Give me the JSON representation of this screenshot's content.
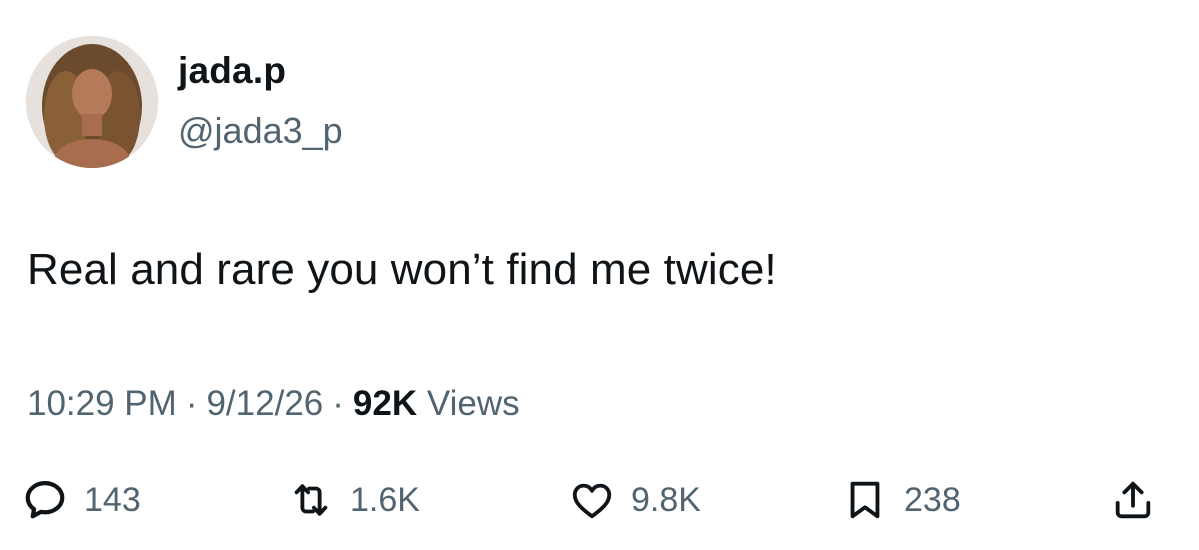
{
  "user": {
    "display_name": "jada.p",
    "handle": "@jada3_p"
  },
  "tweet": {
    "text": "Real and rare you won’t find me twice!"
  },
  "meta": {
    "time": "10:29 PM",
    "separator": "·",
    "date": "9/12/26",
    "views_count": "92K",
    "views_label": "Views"
  },
  "actions": {
    "replies": "143",
    "retweets": "1.6K",
    "likes": "9.8K",
    "bookmarks": "238"
  },
  "icons": {
    "reply": "reply-icon",
    "retweet": "retweet-icon",
    "like": "heart-icon",
    "bookmark": "bookmark-icon",
    "share": "share-icon"
  },
  "colors": {
    "text_primary": "#0f1419",
    "text_secondary": "#536471",
    "background": "#ffffff"
  }
}
